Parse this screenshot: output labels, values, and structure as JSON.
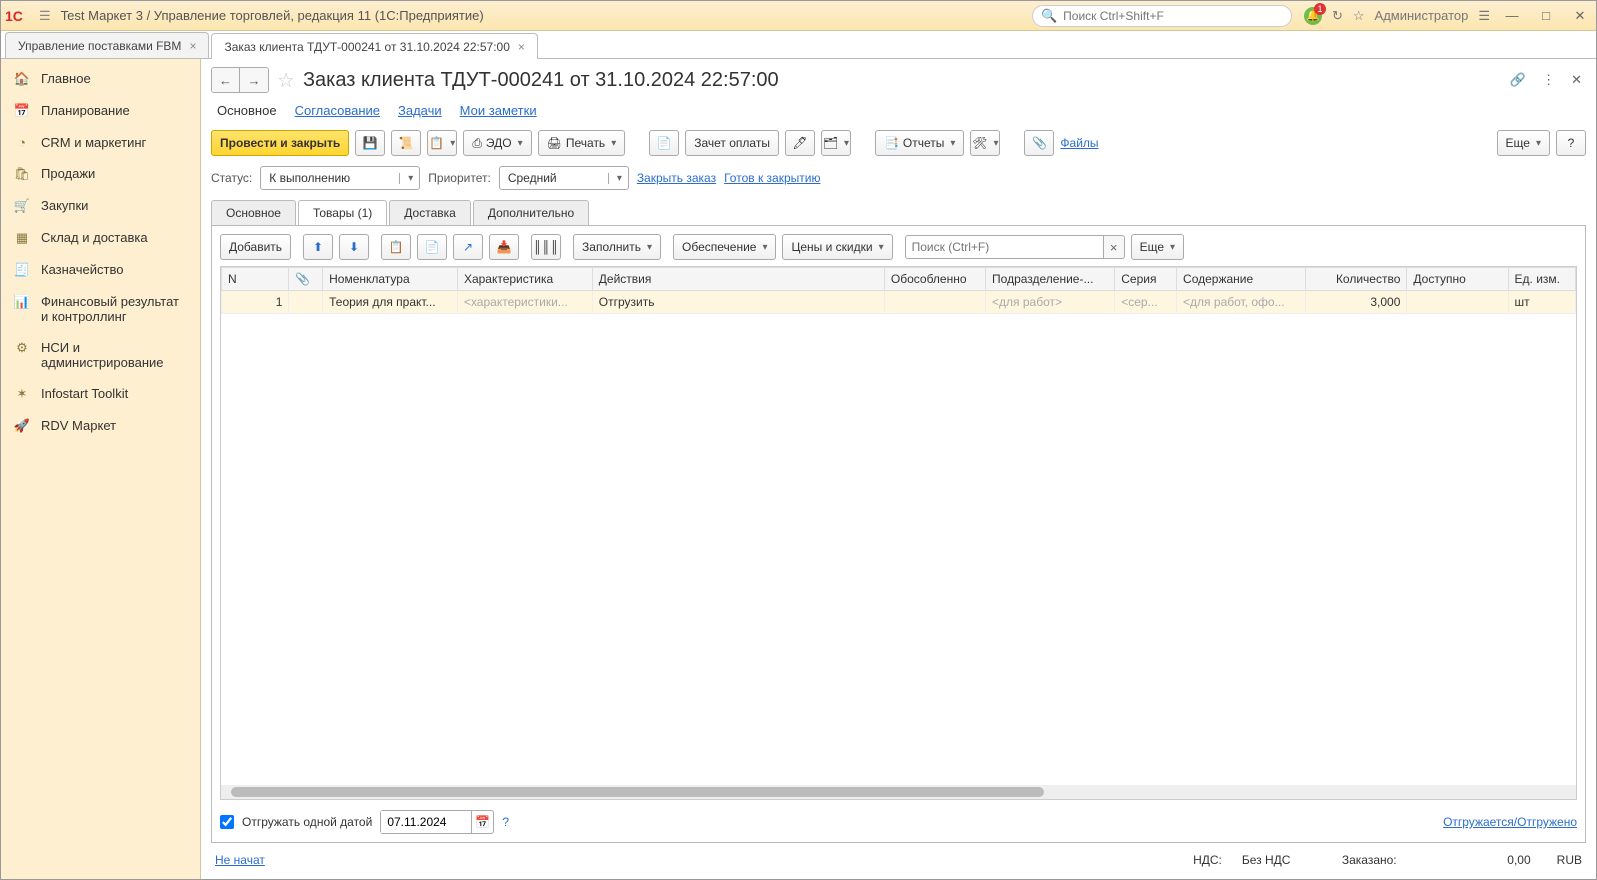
{
  "titlebar": {
    "app_title": "Test Маркет 3 / Управление торговлей, редакция 11  (1С:Предприятие)",
    "search_placeholder": "Поиск Ctrl+Shift+F",
    "user": "Администратор",
    "bell_badge": "1"
  },
  "tabs": [
    {
      "label": "Управление поставками FBM"
    },
    {
      "label": "Заказ клиента ТДУТ-000241 от 31.10.2024 22:57:00",
      "active": true
    }
  ],
  "sidebar": [
    {
      "icon": "🏠",
      "label": "Главное"
    },
    {
      "icon": "📅",
      "label": "Планирование"
    },
    {
      "icon": "◔",
      "label": "CRM и маркетинг"
    },
    {
      "icon": "🛍",
      "label": "Продажи"
    },
    {
      "icon": "🛒",
      "label": "Закупки"
    },
    {
      "icon": "▦",
      "label": "Склад и доставка"
    },
    {
      "icon": "🧾",
      "label": "Казначейство"
    },
    {
      "icon": "📊",
      "label": "Финансовый результат и контроллинг"
    },
    {
      "icon": "⚙",
      "label": "НСИ и администрирование"
    },
    {
      "icon": "✶",
      "label": "Infostart Toolkit"
    },
    {
      "icon": "🚀",
      "label": "RDV Маркет"
    }
  ],
  "doc": {
    "title": "Заказ клиента ТДУТ-000241 от 31.10.2024 22:57:00"
  },
  "subnav": {
    "main": "Основное",
    "approval": "Согласование",
    "tasks": "Задачи",
    "notes": "Мои заметки"
  },
  "toolbar": {
    "post_close": "Провести и закрыть",
    "edo": "ЭДО",
    "print": "Печать",
    "offset": "Зачет оплаты",
    "reports": "Отчеты",
    "files": "Файлы",
    "more": "Еще"
  },
  "status": {
    "status_label": "Статус:",
    "status_value": "К выполнению",
    "priority_label": "Приоритет:",
    "priority_value": "Средний",
    "close_order": "Закрыть заказ",
    "ready_close": "Готов к закрытию"
  },
  "inner_tabs": {
    "main": "Основное",
    "goods": "Товары (1)",
    "delivery": "Доставка",
    "extra": "Дополнительно"
  },
  "goods_toolbar": {
    "add": "Добавить",
    "fill": "Заполнить",
    "provision": "Обеспечение",
    "prices": "Цены и скидки",
    "search_ph": "Поиск (Ctrl+F)",
    "more": "Еще"
  },
  "grid": {
    "headers": {
      "n": "N",
      "nomen": "Номенклатура",
      "char": "Характеристика",
      "actions": "Действия",
      "isolated": "Обособленно",
      "division": "Подразделение-...",
      "series": "Серия",
      "content": "Содержание",
      "qty": "Количество",
      "avail": "Доступно",
      "unit": "Ед. изм."
    },
    "row": {
      "n": "1",
      "nomen": "Теория для практ...",
      "char": "<характеристики...",
      "actions": "Отгрузить",
      "isolated": "",
      "division": "<для работ>",
      "series": "<сер...",
      "content": "<для работ, офо...",
      "qty": "3,000",
      "avail": "",
      "unit": "шт"
    }
  },
  "ship": {
    "checkbox_label": "Отгружать одной датой",
    "date": "07.11.2024",
    "right_link": "Отгружается/Отгружено"
  },
  "bottom": {
    "not_started": "Не начат",
    "nds_label": "НДС:",
    "nds_value": "Без НДС",
    "ordered_label": "Заказано:",
    "ordered_value": "0,00",
    "currency": "RUB"
  }
}
